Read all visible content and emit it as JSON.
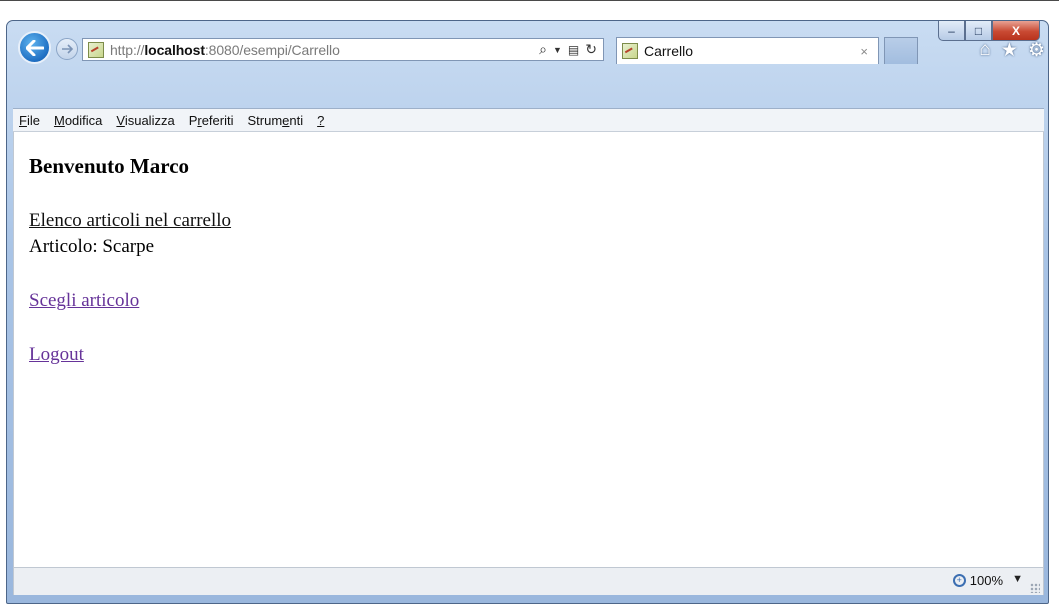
{
  "browser": {
    "address": {
      "url_prefix": "http://",
      "url_host": "localhost",
      "url_rest": ":8080/esempi/Carrello"
    },
    "tab": {
      "title": "Carrello",
      "close": "×"
    },
    "caption": {
      "minimize": "–",
      "maximize": "□",
      "close": "X"
    },
    "menu": [
      {
        "label": "File",
        "accel": "F",
        "rest": "ile"
      },
      {
        "label": "Modifica",
        "accel": "M",
        "rest": "odifica"
      },
      {
        "label": "Visualizza",
        "accel": "V",
        "rest": "isualizza"
      },
      {
        "label": "Preferiti",
        "accel_pre": "P",
        "accel": "r",
        "rest": "eferiti"
      },
      {
        "label": "Strumenti",
        "pre": "Strum",
        "accel": "e",
        "rest": "nti"
      },
      {
        "label": "?",
        "accel": "?",
        "rest": ""
      }
    ],
    "zoom": "100%"
  },
  "page": {
    "heading": "Benvenuto Marco",
    "cart_title": "Elenco articoli nel carrello",
    "article_line": "Articolo: Scarpe",
    "choose_link": "Scegli articolo",
    "logout_link": "Logout"
  },
  "icons": {
    "back": "back-arrow-icon",
    "forward": "forward-arrow-icon",
    "search": "search-icon",
    "compat": "compatibility-view-icon",
    "refresh": "refresh-icon",
    "home": "home-icon",
    "favorites": "star-icon",
    "tools": "gear-icon"
  },
  "colors": {
    "visited_link": "#663399",
    "frame": "#a9c4e6"
  }
}
